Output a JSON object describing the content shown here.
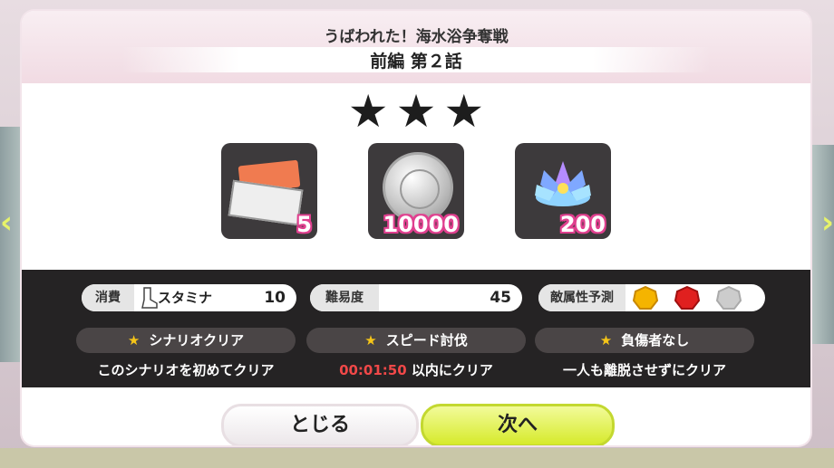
{
  "title": "うばわれた！海水浴争奪戦",
  "subtitle": "前編 第２話",
  "stars_count": 3,
  "rewards": [
    {
      "icon": "ticket-box-icon",
      "count": "5"
    },
    {
      "icon": "silver-coin-icon",
      "count": "10000"
    },
    {
      "icon": "lotus-crystal-icon",
      "count": "200"
    }
  ],
  "info": {
    "stamina_label": "消費",
    "stamina_name": "スタミナ",
    "stamina_value": "10",
    "difficulty_label": "難易度",
    "difficulty_value": "45",
    "enemy_attr_label": "敵属性予測",
    "enemy_attrs": [
      "yellow-gem-icon",
      "red-gem-icon",
      "gray-gem-icon"
    ]
  },
  "conditions": [
    {
      "label": "シナリオクリア",
      "desc": "このシナリオを初めてクリア"
    },
    {
      "label": "スピード討伐",
      "time": "00:01:50",
      "desc_suffix": " 以内にクリア"
    },
    {
      "label": "負傷者なし",
      "desc": "一人も離脱させずにクリア"
    }
  ],
  "buttons": {
    "close_label": "とじる",
    "next_label": "次へ"
  }
}
